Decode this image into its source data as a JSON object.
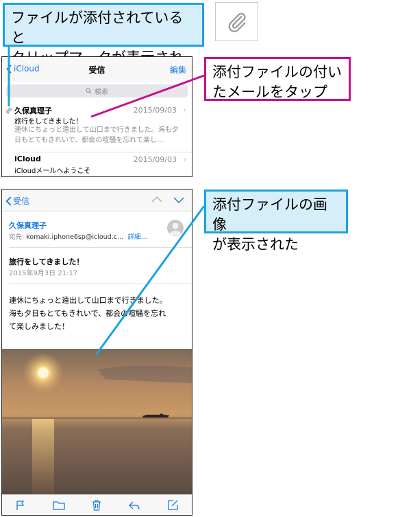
{
  "callouts": {
    "clip_mark": "ファイルが添付されていると\nクリップマークが表示される",
    "tap_mail": "添付ファイルの付い\nたメールをタップ",
    "image_shown": "添付ファイルの画像\nが表示された"
  },
  "inbox": {
    "back_label": "iCloud",
    "title": "受信",
    "edit_label": "編集",
    "search_placeholder": "検索",
    "messages": [
      {
        "sender": "久保真理子",
        "date": "2015/09/03",
        "subject": "旅行をしてきました！",
        "preview": "連休にちょっと遠出して山口まで行きました。海も夕日もとてもきれいで、都会の喧騒を忘れて楽し…",
        "has_attachment": true
      },
      {
        "sender": "iCloud",
        "date": "2015/09/03",
        "subject": "iCloudメールへようこそ",
        "has_attachment": false
      }
    ]
  },
  "detail": {
    "back_label": "受信",
    "from": "久保真理子",
    "to_label": "宛先:",
    "to_address": "komaki.iphone6sp@icloud.c…",
    "details_label": "詳細…",
    "subject": "旅行をしてきました！",
    "date": "2015年9月3日 21:17",
    "body_lines": [
      "連休にちょっと遠出して山口まで行きました。",
      "海も夕日もとてもきれいで、都会の喧騒を忘れ",
      "て楽しみました！"
    ]
  },
  "colors": {
    "callout_blue": "#1aa3e0",
    "callout_magenta": "#c4128c",
    "ios_blue": "#1a7ae0"
  },
  "icons": {
    "toolbar": [
      "flag-icon",
      "folder-icon",
      "trash-icon",
      "reply-icon",
      "compose-icon"
    ]
  }
}
